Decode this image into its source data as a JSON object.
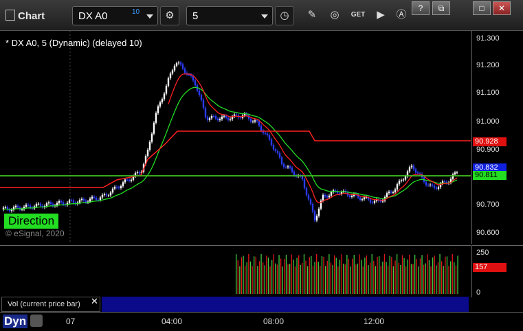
{
  "app": {
    "title": "Chart"
  },
  "toolbar": {
    "symbol": "DX A0",
    "symbol_superscript": "10",
    "interval": "5",
    "buttons": [
      "settings-icon",
      "clock-icon",
      "pencil-icon",
      "chart-style-icon",
      "get-icon",
      "play-icon",
      "a-icon"
    ],
    "get_label": "GET"
  },
  "window_controls": {
    "help": "?",
    "restore": "⧉",
    "maximize": "□",
    "close": "✕"
  },
  "chart": {
    "header": "* DX A0, 5 (Dynamic) (delayed 10)",
    "study_label": "Direction",
    "copyright": "© eSignal, 2020",
    "price_axis": [
      "91.300",
      "91.200",
      "91.100",
      "91.000",
      "90.900",
      "90.800",
      "90.700",
      "90.600"
    ],
    "tags": {
      "red": "90.928",
      "last": "90.832",
      "green": "90.811"
    },
    "colors": {
      "up": "#ffffff",
      "down": "#2a3cff",
      "red": "#ff2020",
      "green": "#22dd22"
    }
  },
  "volume": {
    "label": "Vol (current price bar)",
    "axis": [
      "250",
      "0"
    ],
    "tag": "157"
  },
  "time_axis": [
    "07",
    "04:00",
    "08:00",
    "12:00"
  ],
  "bottom": {
    "dyn_label": "Dyn"
  },
  "chart_data": {
    "type": "candlestick",
    "ylim": [
      90.6,
      91.3
    ],
    "price_line_red_series": [
      90.768,
      90.768,
      90.77,
      90.8,
      90.8,
      90.8,
      90.8,
      90.8,
      90.8,
      90.8,
      90.8
    ],
    "levels": {
      "red_upper": 90.928,
      "red_mid": 90.8,
      "green": 90.811
    },
    "x_labels": [
      "07",
      "04:00",
      "08:00",
      "12:00"
    ]
  }
}
